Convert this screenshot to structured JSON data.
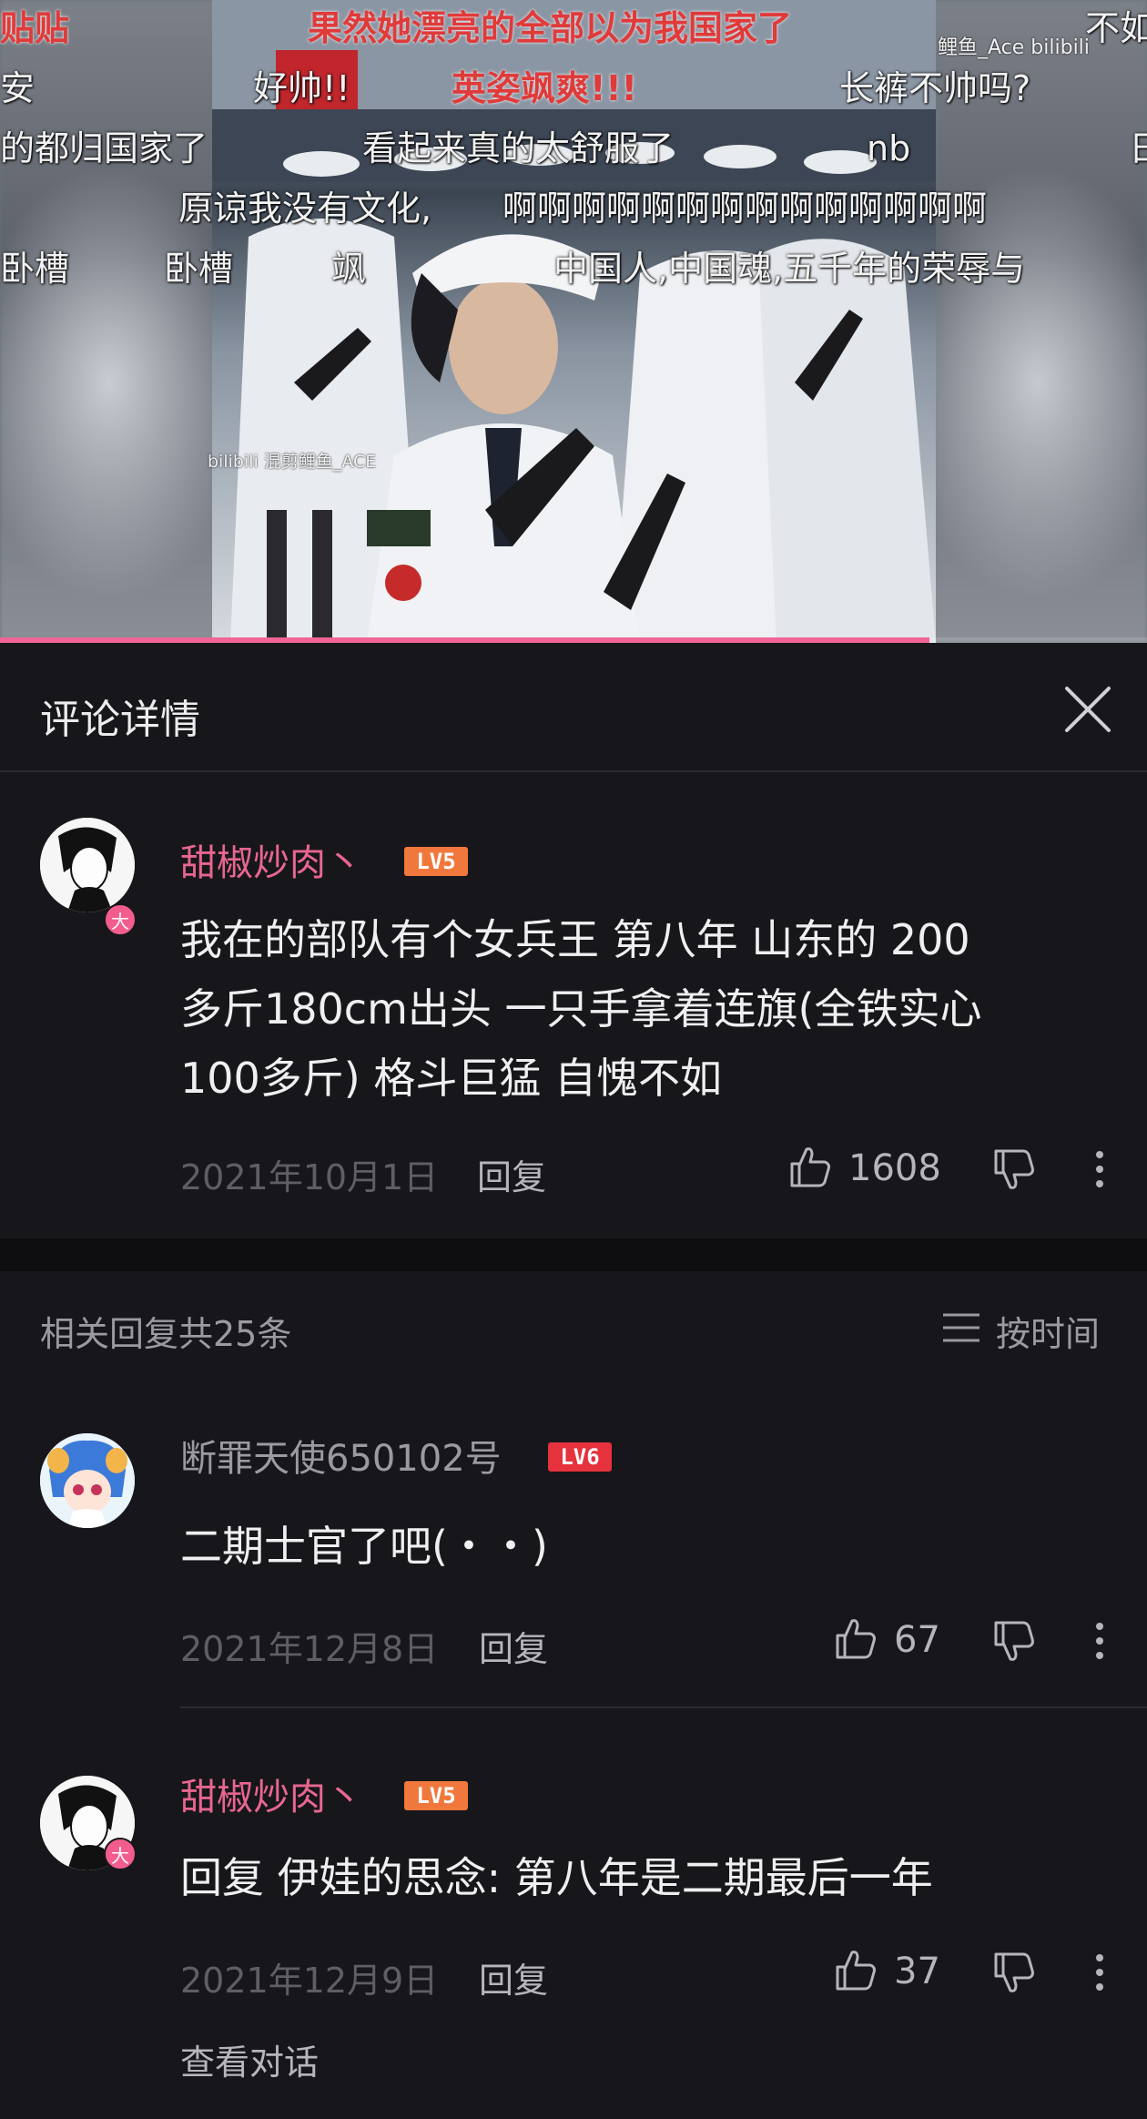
{
  "video": {
    "watermark_top": "鲤鱼_Ace",
    "watermark_logo": "bilibili",
    "watermark_inner": "bilibili 混剪鲤鱼_ACE",
    "progress_fraction": 0.81,
    "danmaku": [
      {
        "text": "果然她漂亮的全部以为我国家了",
        "style": "red"
      },
      {
        "text": "好帅!!",
        "style": "normal"
      },
      {
        "text": "英姿飒爽!!!",
        "style": "red"
      },
      {
        "text": "长裤不帅吗?",
        "style": "normal"
      },
      {
        "text": "的都归国家了",
        "style": "normal"
      },
      {
        "text": "看起来真的太舒服了",
        "style": "normal"
      },
      {
        "text": "nb",
        "style": "normal"
      },
      {
        "text": "原谅我没有文化,",
        "style": "normal"
      },
      {
        "text": "啊啊啊啊啊啊啊啊啊啊啊啊啊啊",
        "style": "normal"
      },
      {
        "text": "卧槽",
        "style": "normal"
      },
      {
        "text": "卧槽",
        "style": "normal"
      },
      {
        "text": "飒",
        "style": "normal"
      },
      {
        "text": "中国人,中国魂,五千年的荣辱与",
        "style": "normal"
      },
      {
        "text": "贴贴",
        "style": "red"
      },
      {
        "text": "不如",
        "style": "normal"
      },
      {
        "text": "安",
        "style": "normal"
      },
      {
        "text": "日",
        "style": "normal"
      }
    ]
  },
  "header": {
    "title": "评论详情",
    "close_icon": "close-icon"
  },
  "main_comment": {
    "username": "甜椒炒肉丶",
    "level": "LV5",
    "avatar_badge": "大",
    "text_lines": [
      "我在的部队有个女兵王  第八年  山东的 200",
      "多斤180cm出头  一只手拿着连旗(全铁实心",
      "100多斤)    格斗巨猛  自愧不如"
    ],
    "date": "2021年10月1日",
    "reply_label": "回复",
    "likes": "1608"
  },
  "replies_header": {
    "label": "相关回复共25条",
    "sort_label": "按时间"
  },
  "replies": [
    {
      "username": "断罪天使650102号",
      "level": "LV6",
      "text": "二期士官了吧(・・)",
      "date": "2021年12月8日",
      "reply_label": "回复",
      "likes": "67"
    },
    {
      "username": "甜椒炒肉丶",
      "level": "LV5",
      "avatar_badge": "大",
      "text": "回复 伊娃的思念: 第八年是二期最后一年",
      "date": "2021年12月9日",
      "reply_label": "回复",
      "likes": "37",
      "view_conversation": "查看对话"
    }
  ],
  "colors": {
    "background": "#17171b",
    "vip_name": "#e8668f",
    "lv5": "#f1783c",
    "lv6": "#e5323d",
    "progress": "#f06595"
  }
}
